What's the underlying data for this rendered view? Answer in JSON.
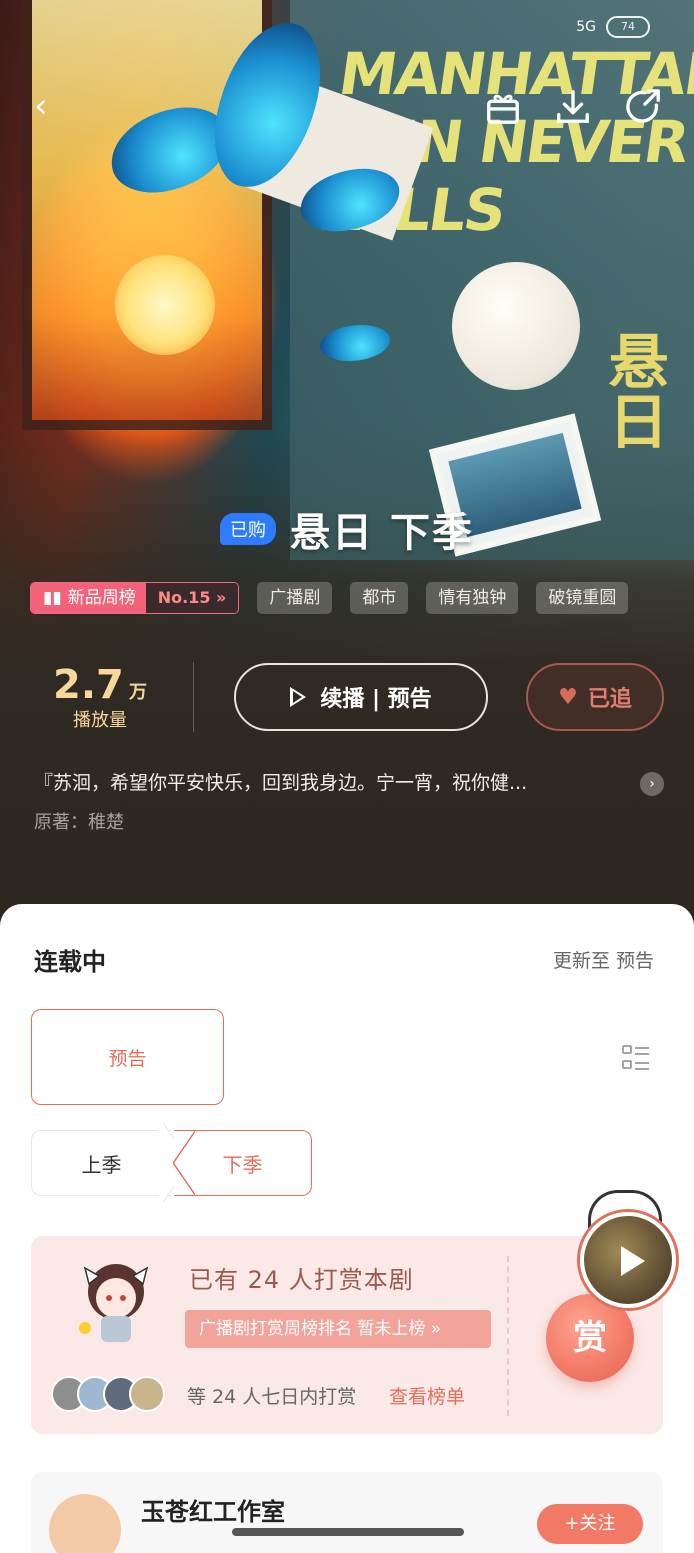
{
  "status_bar": {
    "signal": "5G",
    "battery": "74"
  },
  "hero": {
    "book_cover_text": "MANHATTAN'S SUN NEVER FALLS",
    "book_cover_zh": "悬日"
  },
  "header": {
    "bought_badge": "已购",
    "title": "悬日 下季"
  },
  "tags": {
    "rank_label": "新品周榜",
    "rank_value": "No.15",
    "items": [
      "广播剧",
      "都市",
      "情有独钟",
      "破镜重圆"
    ]
  },
  "stats": {
    "plays_number": "2.7",
    "plays_unit": "万",
    "plays_label": "播放量",
    "play_button_label": "续播 | 预告",
    "follow_button_label": "已追"
  },
  "summary": {
    "text": "『苏洄，希望你平安快乐，回到我身边。宁一宵，祝你健...",
    "author": "原著：稚楚"
  },
  "episodes": {
    "status": "连载中",
    "update_info": "更新至 预告",
    "current_episode": "预告",
    "seasons": [
      "上季",
      "下季"
    ],
    "active_season": "下季"
  },
  "tip": {
    "title": "已有 24 人打赏本剧",
    "rank_text": "广播剧打赏周榜排名 暂未上榜",
    "desc": "等 24 人七日内打赏",
    "link": "查看榜单",
    "button": "赏"
  },
  "studio": {
    "name": "玉苍红工作室",
    "follow_label": "+关注"
  },
  "colors": {
    "accent": "#e26f5c",
    "rank_pink": "#f2637a",
    "badge_blue": "#2d7bff",
    "plays_gold": "#f7d79b"
  }
}
